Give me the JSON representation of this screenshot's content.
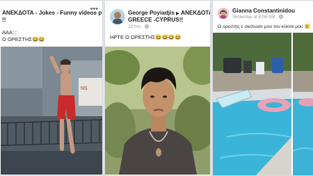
{
  "cards": [
    {
      "page_name": "ΑΝΕΚΔΟΤΑ - Jokes - Funny videos pics",
      "page_name_cont": "!!",
      "caption_line1": "ΑΑΑ:::",
      "caption_line2": "Ο ΟΡΕΣΤΗΣ😂😂",
      "more_icon": "ellipsis-icon"
    },
    {
      "author": "George Poyiadjis",
      "arrow": "▶",
      "group_line1": "ΑΝΕΚΔΟΤΑ",
      "group_line2": "GREECE -CYPRUS!!",
      "time": "22 hrs",
      "privacy_icon": "globe-icon",
      "caption": "ΗΡΤΕ Ο ΟΡΕΣΤΗΣ😂😂😂😂"
    },
    {
      "author": "Gianna Constantinidou",
      "time": "Yesterday at 6:06 AM",
      "privacy_icon": "globe-icon",
      "caption": "Ο ορεστης ε σκότωσε μου τον κύκνο μου 😢"
    }
  ]
}
